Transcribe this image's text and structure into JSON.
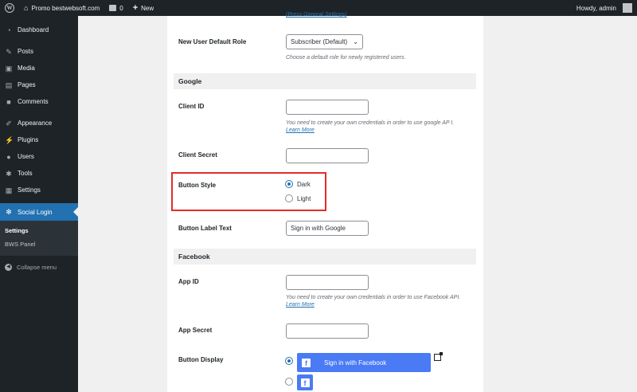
{
  "adminbar": {
    "site_name": "Promo bestwebsoft.com",
    "comments_count": "0",
    "new_label": "New",
    "howdy": "Howdy, admin"
  },
  "sidebar": {
    "items": [
      {
        "label": "Dashboard",
        "icon": "dashboard-icon"
      },
      {
        "label": "Posts",
        "icon": "pin-icon"
      },
      {
        "label": "Media",
        "icon": "media-icon"
      },
      {
        "label": "Pages",
        "icon": "pages-icon"
      },
      {
        "label": "Comments",
        "icon": "comment-icon"
      },
      {
        "label": "Appearance",
        "icon": "brush-icon"
      },
      {
        "label": "Plugins",
        "icon": "plugin-icon"
      },
      {
        "label": "Users",
        "icon": "users-icon"
      },
      {
        "label": "Tools",
        "icon": "wrench-icon"
      },
      {
        "label": "Settings",
        "icon": "settings-icon"
      },
      {
        "label": "Social Login",
        "icon": "gear-icon"
      }
    ],
    "submenu": [
      "Settings",
      "BWS Panel"
    ],
    "collapse_label": "Collapse menu"
  },
  "content": {
    "top_cut_link": "(Press General Settings)",
    "new_user_role_label": "New User Default Role",
    "new_user_role_value": "Subscriber (Default)",
    "new_user_role_desc": "Choose a default role for newly registered users.",
    "google_section": "Google",
    "client_id_label": "Client ID",
    "client_id_desc": "You need to create your own credentials in order to use google AP I.",
    "learn_more": "Learn More",
    "client_secret_label": "Client Secret",
    "button_style_label": "Button Style",
    "style_dark": "Dark",
    "style_light": "Light",
    "button_label_text_label": "Button Label Text",
    "button_label_text_value": "Sign in with Google",
    "facebook_section": "Facebook",
    "app_id_label": "App ID",
    "app_id_desc": "You need to create your own credentials in order to use Facebook API.",
    "app_secret_label": "App Secret",
    "button_display_label": "Button Display",
    "fb_button_text": "Sign in with Facebook",
    "fb_letter": "f"
  },
  "colors": {
    "accent": "#2271b1",
    "highlight": "#e32b2b",
    "facebook_blue": "#4a7bf4"
  }
}
